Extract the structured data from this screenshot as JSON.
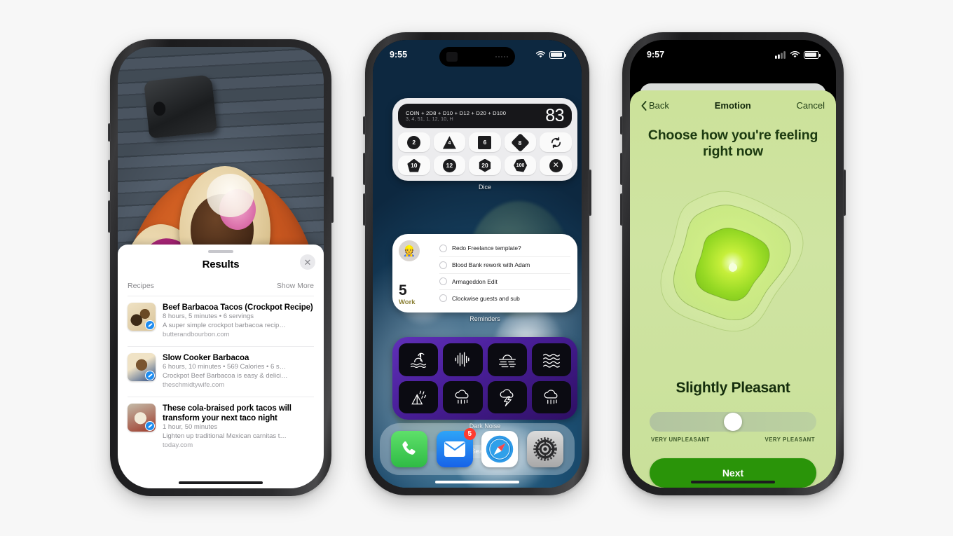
{
  "background_color": "#f7f7f7",
  "phone1": {
    "name": "Photos Visual Look Up",
    "photo_alt": "Plate of barbacoa tacos on an orange plate on a dark wooden table",
    "sheet": {
      "title": "Results",
      "close_icon": "close-icon",
      "category": "Recipes",
      "show_more": "Show More",
      "results": [
        {
          "title": "Beef Barbacoa Tacos (Crockpot Recipe)",
          "meta": "8 hours, 5 minutes • 6 servings",
          "desc": "A super simple crockpot barbacoa recip…",
          "source": "butterandbourbon.com"
        },
        {
          "title": "Slow Cooker Barbacoa",
          "meta": "6 hours, 10 minutes • 569 Calories • 6 s…",
          "desc": "Crockpot Beef Barbacoa is easy & delici…",
          "source": "theschmidtywife.com"
        },
        {
          "title": "These cola-braised pork tacos will transform your next taco night",
          "meta": "1 hour, 50 minutes",
          "desc": "Lighten up traditional Mexican carnitas t…",
          "source": "today.com"
        }
      ]
    }
  },
  "phone2": {
    "name": "iOS Home Screen with widgets",
    "statusbar": {
      "time": "9:55",
      "wifi_icon": "wifi-icon",
      "battery_icon": "battery-icon"
    },
    "dice_widget": {
      "label": "Dice",
      "formula": "COIN + 2D8 + D10 + D12 + D20 + D100",
      "rolls": "3, 4, 51, 1, 12, 10, H",
      "total": "83",
      "keys": [
        {
          "label": "2",
          "shape": "circle",
          "name": "dice-d2-button"
        },
        {
          "label": "4",
          "shape": "triangle",
          "name": "dice-d4-button"
        },
        {
          "label": "6",
          "shape": "square",
          "name": "dice-d6-button"
        },
        {
          "label": "8",
          "shape": "diamond",
          "name": "dice-d8-button"
        },
        {
          "label": "",
          "shape": "refresh",
          "name": "dice-reroll-button"
        },
        {
          "label": "10",
          "shape": "pentagon",
          "name": "dice-d10-button"
        },
        {
          "label": "12",
          "shape": "circle",
          "name": "dice-d12-button"
        },
        {
          "label": "20",
          "shape": "hexagon",
          "name": "dice-d20-button"
        },
        {
          "label": "100",
          "shape": "d100",
          "name": "dice-d100-button"
        },
        {
          "label": "",
          "shape": "clear",
          "name": "dice-clear-button"
        }
      ]
    },
    "reminders_widget": {
      "label": "Reminders",
      "avatar_icon": "person-avatar-icon",
      "count": "5",
      "list_name": "Work",
      "items": [
        "Redo Freelance template?",
        "Blood Bank rework with Adam",
        "Armageddon Edit",
        "Clockwise guests and sub"
      ]
    },
    "darknoise_widget": {
      "label": "Dark Noise",
      "sounds": [
        "island-icon",
        "soundwave-icon",
        "ocean-sunset-icon",
        "waves-icon",
        "tent-rain-icon",
        "rain-cloud-icon",
        "thunderstorm-icon",
        "rain-cloud-icon"
      ]
    },
    "search_pill": {
      "label": "Search",
      "icon": "search-icon"
    },
    "dock": [
      {
        "name": "phone-app",
        "label": "Phone",
        "icon": "phone-icon",
        "badge": ""
      },
      {
        "name": "mail-app",
        "label": "Mail",
        "icon": "mail-icon",
        "badge": "5"
      },
      {
        "name": "safari-app",
        "label": "Safari",
        "icon": "compass-icon",
        "badge": ""
      },
      {
        "name": "settings-app",
        "label": "Settings",
        "icon": "gear-icon",
        "badge": ""
      }
    ]
  },
  "phone3": {
    "name": "Health app — State of Mind",
    "statusbar": {
      "time": "9:57",
      "cellular_icon": "cellular-icon",
      "wifi_icon": "wifi-icon",
      "battery_icon": "battery-icon"
    },
    "nav": {
      "back": "Back",
      "title": "Emotion",
      "cancel": "Cancel",
      "back_icon": "chevron-left-icon"
    },
    "heading": "Choose how you're feeling right now",
    "graphic": "emotion-blob-graphic",
    "value": "Slightly Pleasant",
    "slider": {
      "min_label": "VERY UNPLEASANT",
      "max_label": "VERY PLEASANT",
      "position_percent": 50
    },
    "next_button": "Next",
    "accent_color": "#2a9409",
    "sheet_color": "#cce29a"
  }
}
